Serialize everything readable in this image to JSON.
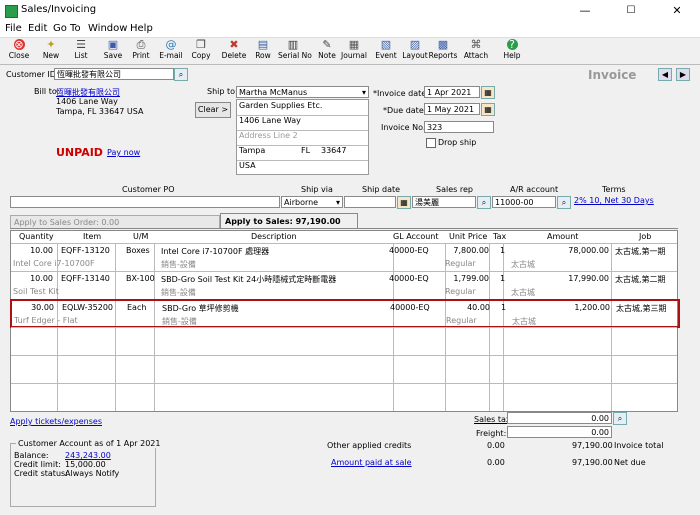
{
  "window": {
    "title": "Sales/Invoicing",
    "min": "—",
    "max": "☐",
    "close": "✕"
  },
  "menu": [
    "File",
    "Edit",
    "Go To",
    "Window",
    "Help"
  ],
  "toolbar": [
    {
      "label": "Close",
      "icon": "close-icon",
      "glyph": "⊗",
      "color": "#c0392b"
    },
    {
      "label": "New",
      "icon": "new-icon",
      "glyph": "✦",
      "color": "#c49a2c"
    },
    {
      "label": "List",
      "icon": "list-icon",
      "glyph": "☰",
      "color": "#444"
    },
    {
      "label": "Save",
      "icon": "save-icon",
      "glyph": "▣",
      "color": "#3b5ea8"
    },
    {
      "label": "Print",
      "icon": "print-icon",
      "glyph": "⎙",
      "color": "#444"
    },
    {
      "label": "E-mail",
      "icon": "email-icon",
      "glyph": "@",
      "color": "#2a7ab8"
    },
    {
      "label": "Copy",
      "icon": "copy-icon",
      "glyph": "❐",
      "color": "#444"
    },
    {
      "label": "Delete",
      "icon": "delete-icon",
      "glyph": "✖",
      "color": "#c0392b"
    },
    {
      "label": "Row",
      "icon": "row-icon",
      "glyph": "▤",
      "color": "#3b5ea8"
    },
    {
      "label": "Serial No",
      "icon": "serial-icon",
      "glyph": "▥",
      "color": "#333"
    },
    {
      "label": "Note",
      "icon": "note-icon",
      "glyph": "✎",
      "color": "#444"
    },
    {
      "label": "Journal",
      "icon": "journal-icon",
      "glyph": "▦",
      "color": "#555"
    },
    {
      "label": "Event",
      "icon": "event-icon",
      "glyph": "▧",
      "color": "#3b5ea8"
    },
    {
      "label": "Layout",
      "icon": "layout-icon",
      "glyph": "▨",
      "color": "#3b5ea8"
    },
    {
      "label": "Reports",
      "icon": "reports-icon",
      "glyph": "▩",
      "color": "#3b5ea8"
    },
    {
      "label": "Attach",
      "icon": "attach-icon",
      "glyph": "⌘",
      "color": "#555"
    },
    {
      "label": "Help",
      "icon": "help-icon",
      "glyph": "?",
      "color": "#fff"
    }
  ],
  "header": {
    "customer_id_label": "Customer ID:",
    "customer_id": "恆暉批發有限公司",
    "invoice_title": "Invoice"
  },
  "bill_to": {
    "label": "Bill to:",
    "name": "恆暉批發有限公司",
    "line1": "1406 Lane Way",
    "line2": "Tampa, FL 33647 USA"
  },
  "ship_to": {
    "label": "Ship to:",
    "name": "Martha McManus",
    "clear": "Clear >",
    "addr": [
      "Garden Supplies Etc.",
      "1406 Lane Way",
      "Address Line 2"
    ],
    "city": "Tampa",
    "state": "FL",
    "zip": "33647",
    "country": "USA"
  },
  "invoice": {
    "date_label": "*Invoice date:",
    "date": "1 Apr 2021",
    "due_label": "*Due date:",
    "due": "1 May 2021",
    "no_label": "Invoice No.:",
    "no": "323",
    "drop_ship": "Drop ship"
  },
  "status": {
    "unpaid": "UNPAID",
    "pay_now": "Pay now"
  },
  "po_row": {
    "customer_po": "Customer PO",
    "ship_via": "Ship via",
    "ship_date": "Ship date",
    "sales_rep": "Sales rep",
    "ar_account": "A/R account",
    "terms": "Terms",
    "ship_via_value": "Airborne",
    "sales_rep_value": "湯美麗",
    "ar_value": "11000-00",
    "terms_value": "2% 10, Net 30 Days"
  },
  "tabs": {
    "apply_order": "Apply to Sales Order: 0.00",
    "apply_sales": "Apply to Sales: 97,190.00"
  },
  "columns": [
    "Quantity",
    "Item",
    "U/M",
    "Description",
    "GL Account",
    "Unit Price",
    "Tax",
    "Amount",
    "Job"
  ],
  "lines": [
    {
      "qty": "10.00",
      "item": "EQFF-13120",
      "um": "Boxes",
      "desc": "Intel Core i7-10700F 處理器",
      "gl": "40000-EQ",
      "price": "7,800.00",
      "tax": "1",
      "amount": "78,000.00",
      "job": "太古城,第一期",
      "sub_item": "Intel Core i7-10700F",
      "sub_desc": "銷售-設備",
      "sub_price": "Regular",
      "sub_amount": "太古城"
    },
    {
      "qty": "10.00",
      "item": "EQFF-13140",
      "um": "BX-100",
      "desc": "SBD-Gro Soil Test Kit 24小時隱械式定時斷電器",
      "gl": "40000-EQ",
      "price": "1,799.00",
      "tax": "1",
      "amount": "17,990.00",
      "job": "太古城,第二期",
      "sub_item": "Soil Test Kit",
      "sub_desc": "銷售-設備",
      "sub_price": "Regular",
      "sub_amount": "太古城"
    },
    {
      "qty": "30.00",
      "item": "EQLW-35200",
      "um": "Each",
      "desc": "SBD-Gro 草坪修剪機",
      "gl": "40000-EQ",
      "price": "40.00",
      "tax": "1",
      "amount": "1,200.00",
      "job": "太古城,第三期",
      "sub_item": "Turf Edger - Flat",
      "sub_desc": "銷售-設備",
      "sub_price": "Regular",
      "sub_amount": "太古城"
    }
  ],
  "footer": {
    "apply_tickets": "Apply tickets/expenses",
    "sales_tax_label": "Sales tax:",
    "sales_tax": "0.00",
    "freight_label": "Freight:",
    "freight": "0.00",
    "other_credits_label": "Other applied credits",
    "other_credits": "0.00",
    "invoice_total": "97,190.00",
    "invoice_total_label": "Invoice total",
    "paid_label": "Amount paid at sale",
    "paid": "0.00",
    "net_due": "97,190.00",
    "net_due_label": "Net due"
  },
  "account": {
    "title": "Customer Account as of 1 Apr 2021",
    "balance_label": "Balance:",
    "balance": "243,243.00",
    "credit_limit_label": "Credit limit:",
    "credit_limit": "15,000.00",
    "credit_status_label": "Credit status:",
    "credit_status": "Always Notify"
  }
}
